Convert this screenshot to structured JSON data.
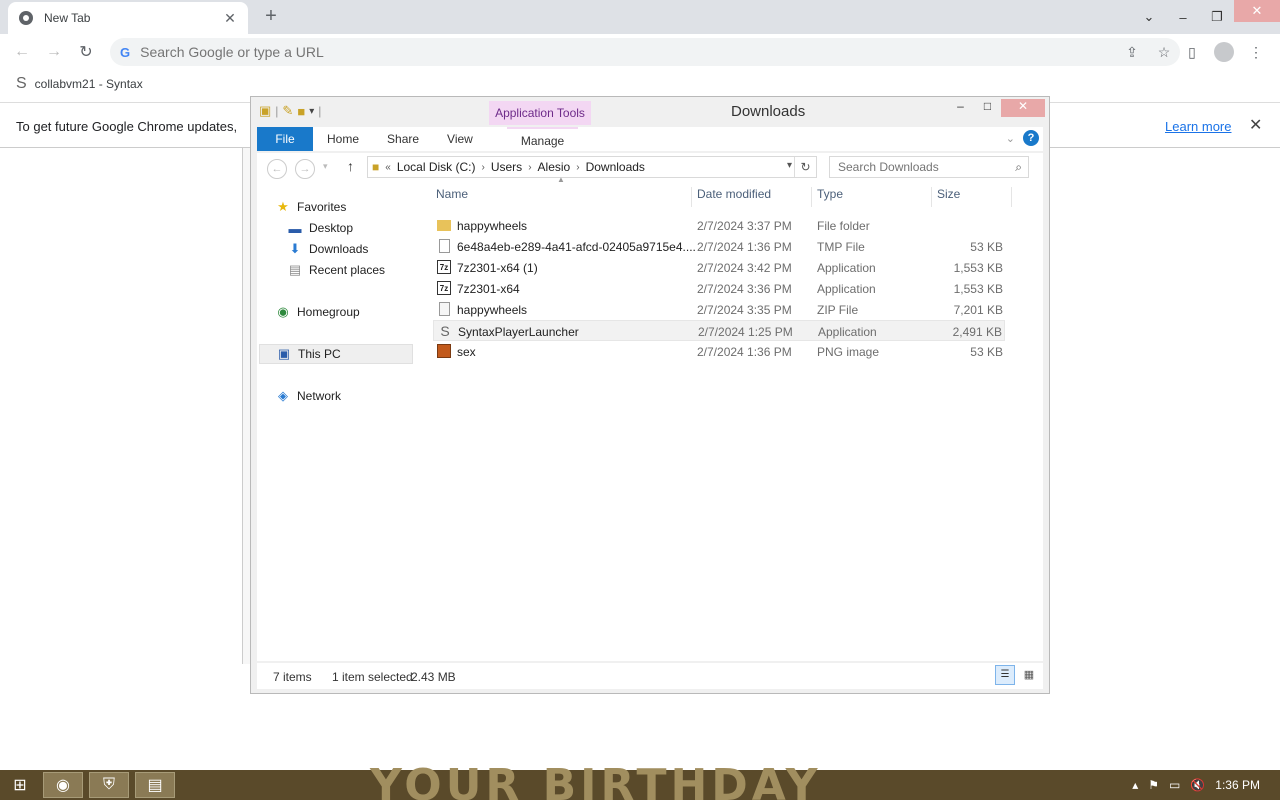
{
  "chrome": {
    "tab_title": "New Tab",
    "omnibox_placeholder": "Search Google or type a URL",
    "bookmark_label": "collabvm21 - Syntax",
    "infobar_text": "To get future Google Chrome updates,",
    "infobar_link": "Learn more"
  },
  "explorer": {
    "title": "Downloads",
    "context_tab": "Application Tools",
    "ribbon_tabs": [
      "File",
      "Home",
      "Share",
      "View",
      "Manage"
    ],
    "breadcrumb": [
      "Local Disk (C:)",
      "Users",
      "Alesio",
      "Downloads"
    ],
    "search_placeholder": "Search Downloads",
    "nav": {
      "favorites": "Favorites",
      "desktop": "Desktop",
      "downloads": "Downloads",
      "recent": "Recent places",
      "homegroup": "Homegroup",
      "thispc": "This PC",
      "network": "Network"
    },
    "columns": {
      "name": "Name",
      "date": "Date modified",
      "type": "Type",
      "size": "Size"
    },
    "files": [
      {
        "name": "happywheels",
        "date": "2/7/2024 3:37 PM",
        "type": "File folder",
        "size": "",
        "icon": "folder-icon"
      },
      {
        "name": "6e48a4eb-e289-4a41-afcd-02405a9715e4....",
        "date": "2/7/2024 1:36 PM",
        "type": "TMP File",
        "size": "53 KB",
        "icon": "blank-file-icon"
      },
      {
        "name": "7z2301-x64 (1)",
        "date": "2/7/2024 3:42 PM",
        "type": "Application",
        "size": "1,553 KB",
        "icon": "7zip-icon"
      },
      {
        "name": "7z2301-x64",
        "date": "2/7/2024 3:36 PM",
        "type": "Application",
        "size": "1,553 KB",
        "icon": "7zip-icon"
      },
      {
        "name": "happywheels",
        "date": "2/7/2024 3:35 PM",
        "type": "ZIP File",
        "size": "7,201 KB",
        "icon": "zip-icon"
      },
      {
        "name": "SyntaxPlayerLauncher",
        "date": "2/7/2024 1:25 PM",
        "type": "Application",
        "size": "2,491 KB",
        "icon": "syntax-icon"
      },
      {
        "name": "sex",
        "date": "2/7/2024 1:36 PM",
        "type": "PNG image",
        "size": "53 KB",
        "icon": "image-icon"
      }
    ],
    "status": {
      "count": "7 items",
      "selected": "1 item selected",
      "size": "2.43 MB"
    }
  },
  "taskbar": {
    "clock": "1:36 PM",
    "wallpaper_text": "YOUR BIRTHDAY"
  }
}
